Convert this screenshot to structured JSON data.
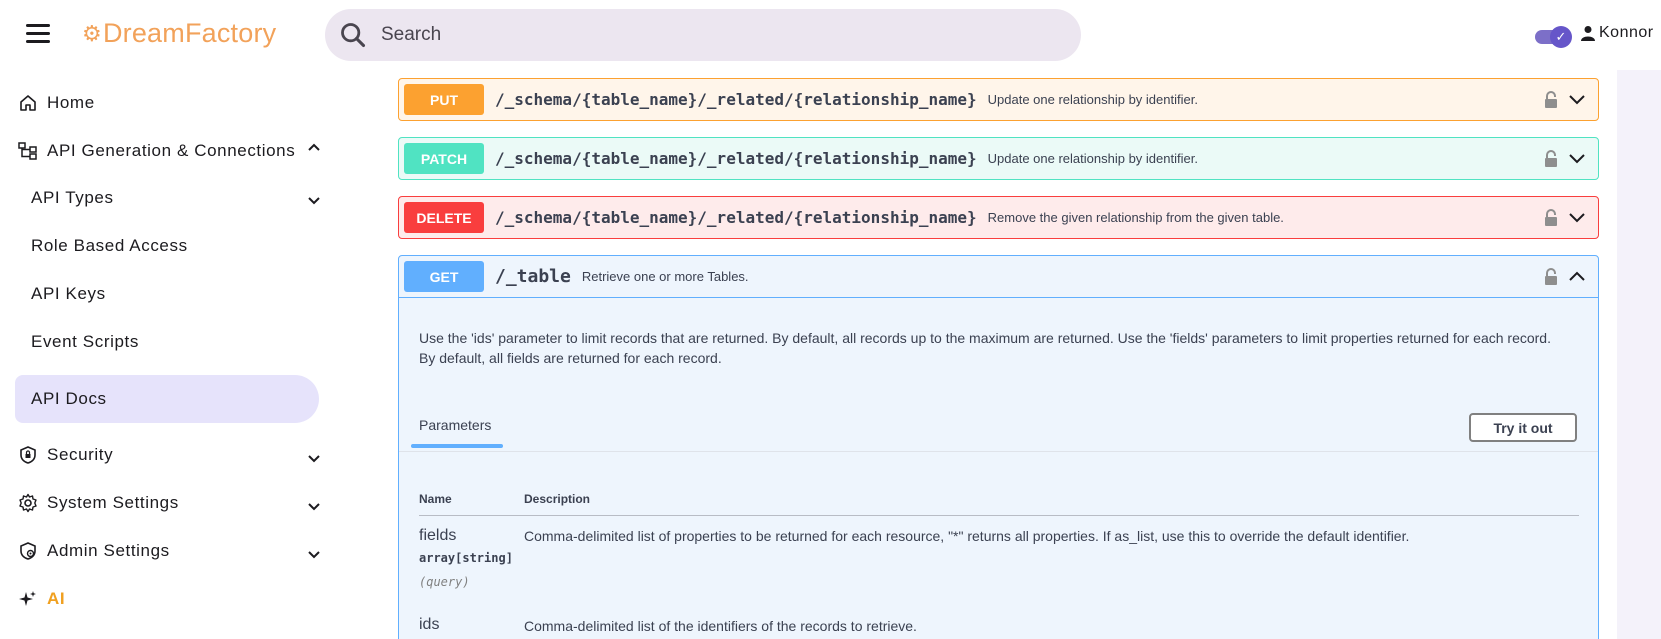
{
  "header": {
    "logo": "DreamFactory",
    "search_placeholder": "Search",
    "user_name": "Konnor",
    "theme_toggle_on": true
  },
  "sidebar": {
    "home": "Home",
    "api_gen": "API Generation & Connections",
    "api_types": "API Types",
    "role_access": "Role Based Access",
    "api_keys": "API Keys",
    "event_scripts": "Event Scripts",
    "api_docs": "API Docs",
    "security": "Security",
    "system_settings": "System Settings",
    "admin_settings": "Admin Settings",
    "ai": "AI"
  },
  "operations": [
    {
      "method": "PUT",
      "path": "/_schema/{table_name}/_related/{relationship_name}",
      "summary": "Update one relationship by identifier."
    },
    {
      "method": "PATCH",
      "path": "/_schema/{table_name}/_related/{relationship_name}",
      "summary": "Update one relationship by identifier."
    },
    {
      "method": "DELETE",
      "path": "/_schema/{table_name}/_related/{relationship_name}",
      "summary": "Remove the given relationship from the given table."
    },
    {
      "method": "GET",
      "path": "/_table",
      "summary": "Retrieve one or more Tables."
    }
  ],
  "get_table": {
    "description": "Use the 'ids' parameter to limit records that are returned. By default, all records up to the maximum are returned. Use the 'fields' parameters to limit properties returned for each record. By default, all fields are returned for each record.",
    "tab_label": "Parameters",
    "try_label": "Try it out",
    "col_name": "Name",
    "col_desc": "Description",
    "params": [
      {
        "name": "fields",
        "type": "array[string]",
        "in": "(query)",
        "description": "Comma-delimited list of properties to be returned for each resource, \"*\" returns all properties. If as_list, use this to override the default identifier."
      },
      {
        "name": "ids",
        "description": "Comma-delimited list of the identifiers of the records to retrieve."
      }
    ]
  },
  "colors": {
    "put": "#fca130",
    "patch": "#50e3c2",
    "delete": "#f93e3e",
    "get": "#61affe",
    "accent": "#6656c9",
    "logo": "#f2a25a"
  }
}
